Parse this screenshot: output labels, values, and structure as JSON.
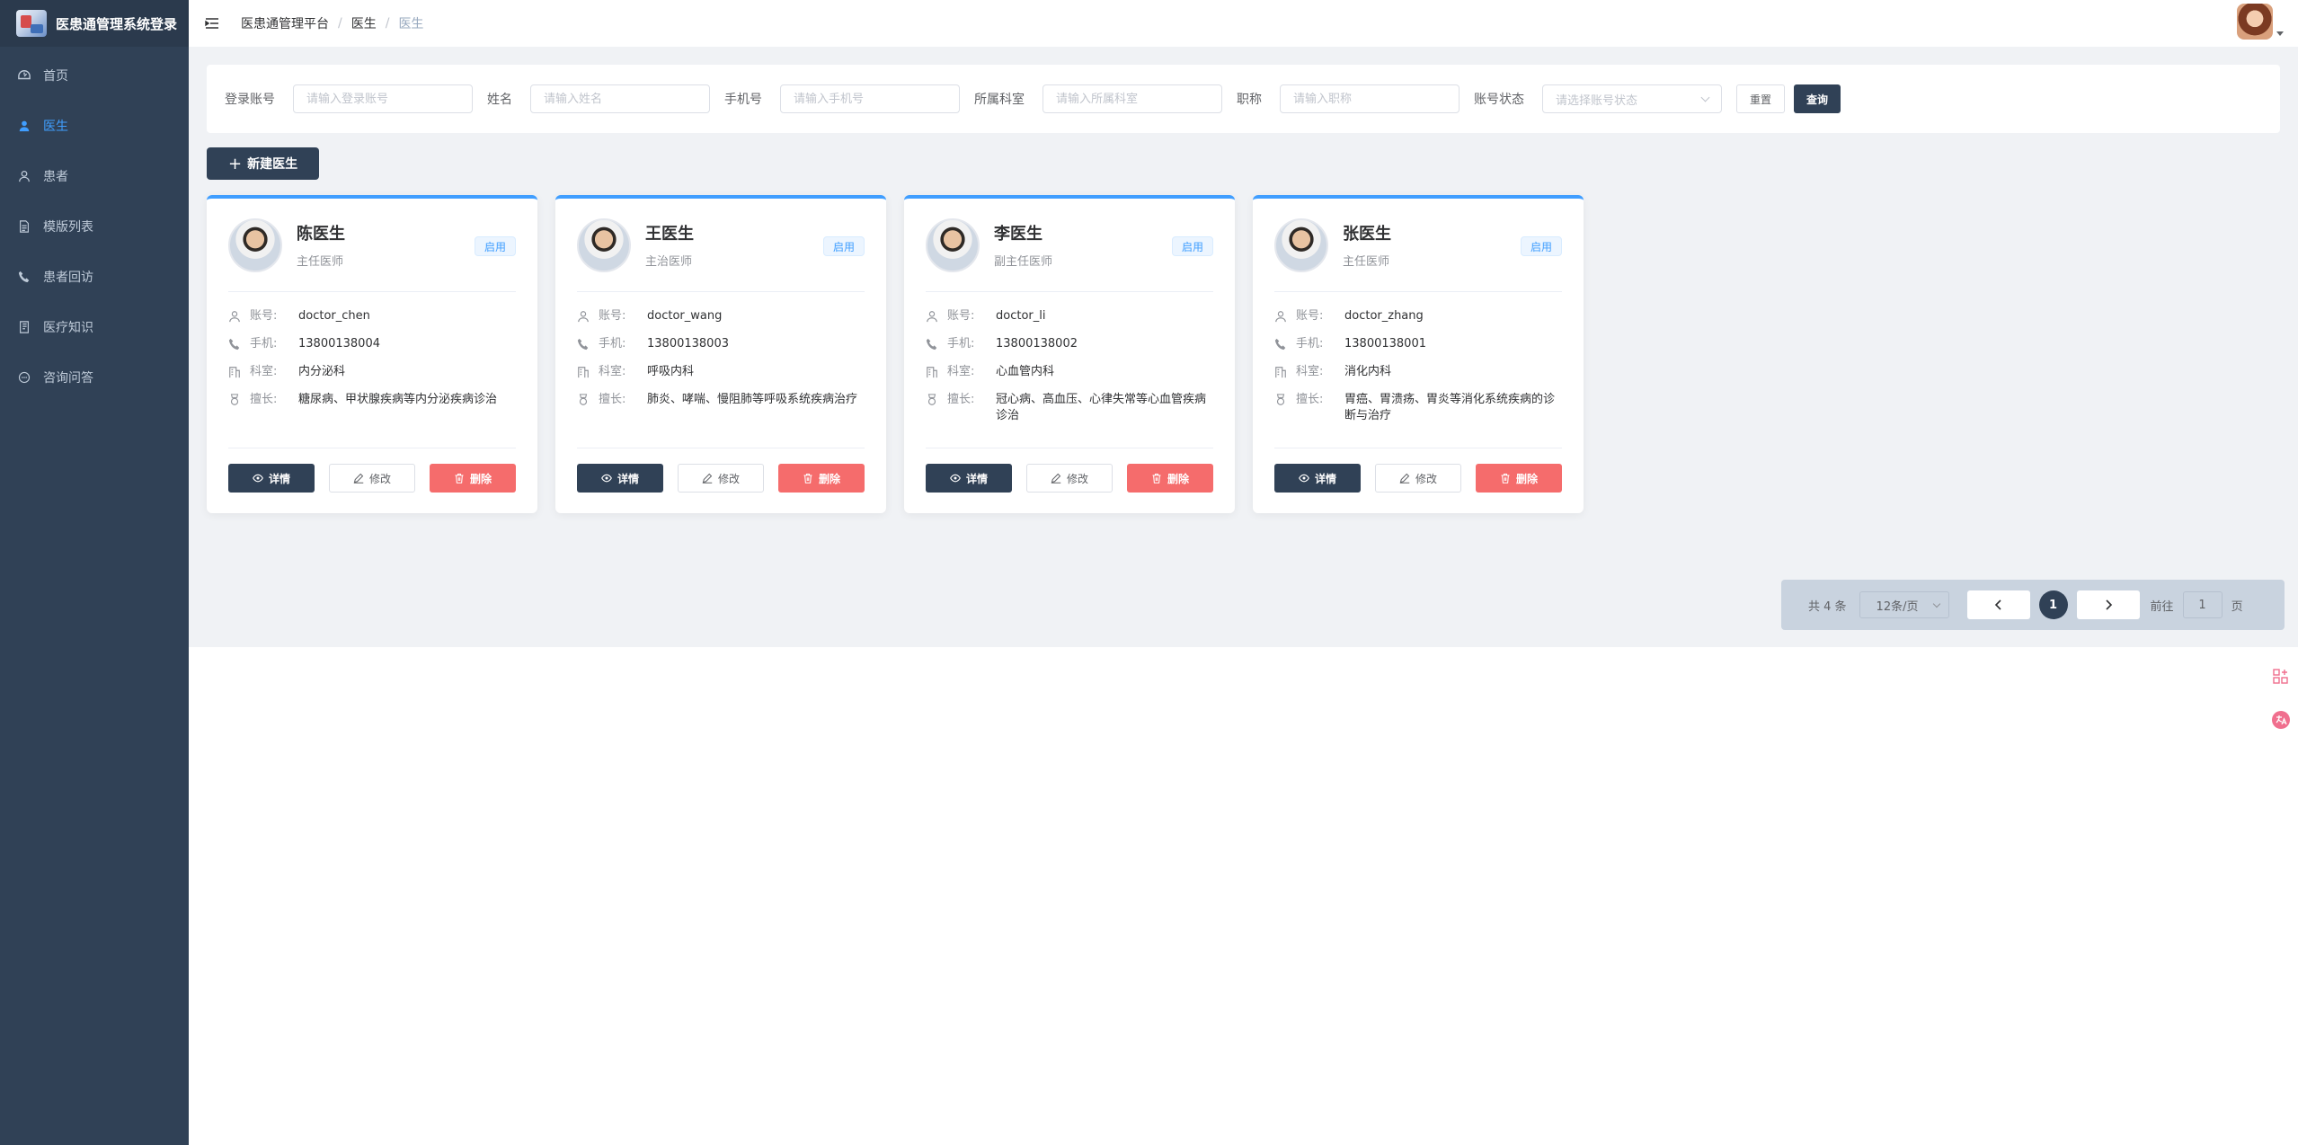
{
  "app": {
    "title": "医患通管理系统登录"
  },
  "sidebar": {
    "items": [
      {
        "label": "首页",
        "icon": "dashboard-icon",
        "active": false
      },
      {
        "label": "医生",
        "icon": "user-icon",
        "active": true
      },
      {
        "label": "患者",
        "icon": "person-outline-icon",
        "active": false
      },
      {
        "label": "模版列表",
        "icon": "document-icon",
        "active": false
      },
      {
        "label": "患者回访",
        "icon": "phone-icon",
        "active": false
      },
      {
        "label": "医疗知识",
        "icon": "book-icon",
        "active": false
      },
      {
        "label": "咨询问答",
        "icon": "chat-icon",
        "active": false
      }
    ]
  },
  "header": {
    "breadcrumb": [
      "医患通管理平台",
      "医生",
      "医生"
    ]
  },
  "filter": {
    "account": {
      "label": "登录账号",
      "placeholder": "请输入登录账号"
    },
    "name": {
      "label": "姓名",
      "placeholder": "请输入姓名"
    },
    "phone": {
      "label": "手机号",
      "placeholder": "请输入手机号"
    },
    "dept": {
      "label": "所属科室",
      "placeholder": "请输入所属科室"
    },
    "title": {
      "label": "职称",
      "placeholder": "请输入职称"
    },
    "status": {
      "label": "账号状态",
      "placeholder": "请选择账号状态"
    },
    "reset_label": "重置",
    "query_label": "查询"
  },
  "new_button": "新建医生",
  "field_labels": {
    "account": "账号:",
    "phone": "手机:",
    "dept": "科室:",
    "specialty": "擅长:"
  },
  "actions": {
    "detail": "详情",
    "edit": "修改",
    "delete": "删除"
  },
  "doctors": [
    {
      "name": "陈医生",
      "title": "主任医师",
      "status": "启用",
      "account": "doctor_chen",
      "phone": "13800138004",
      "dept": "内分泌科",
      "specialty": "糖尿病、甲状腺疾病等内分泌疾病诊治"
    },
    {
      "name": "王医生",
      "title": "主治医师",
      "status": "启用",
      "account": "doctor_wang",
      "phone": "13800138003",
      "dept": "呼吸内科",
      "specialty": "肺炎、哮喘、慢阻肺等呼吸系统疾病治疗"
    },
    {
      "name": "李医生",
      "title": "副主任医师",
      "status": "启用",
      "account": "doctor_li",
      "phone": "13800138002",
      "dept": "心血管内科",
      "specialty": "冠心病、高血压、心律失常等心血管疾病诊治"
    },
    {
      "name": "张医生",
      "title": "主任医师",
      "status": "启用",
      "account": "doctor_zhang",
      "phone": "13800138001",
      "dept": "消化内科",
      "specialty": "胃癌、胃溃疡、胃炎等消化系统疾病的诊断与治疗"
    }
  ],
  "pagination": {
    "total": "共 4 条",
    "page_size": "12条/页",
    "current": "1",
    "goto_label": "前往",
    "goto_value": "1",
    "page_suffix": "页"
  },
  "colors": {
    "sidebar": "#304156",
    "accent": "#409eff",
    "danger": "#f56c6c"
  }
}
